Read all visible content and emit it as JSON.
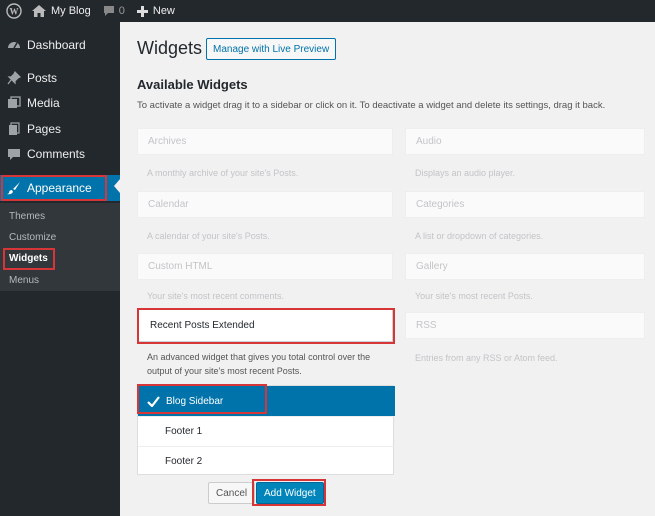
{
  "adminbar": {
    "site_name": "My Blog",
    "comments_count": "0",
    "new_label": "New"
  },
  "sidebar": {
    "items": [
      {
        "label": "Dashboard",
        "icon": "dashboard-icon"
      },
      {
        "label": "Posts",
        "icon": "pin-icon"
      },
      {
        "label": "Media",
        "icon": "media-icon"
      },
      {
        "label": "Pages",
        "icon": "pages-icon"
      },
      {
        "label": "Comments",
        "icon": "comment-icon"
      },
      {
        "label": "Appearance",
        "icon": "brush-icon",
        "current": true
      }
    ],
    "submenu": [
      "Themes",
      "Customize",
      "Widgets",
      "Menus"
    ],
    "current_submenu": "Widgets"
  },
  "main": {
    "title": "Widgets",
    "live_preview_label": "Manage with Live Preview",
    "available_heading": "Available Widgets",
    "description": "To activate a widget drag it to a sidebar or click on it. To deactivate a widget and delete its settings, drag it back.",
    "widgets_left": [
      {
        "title": "Archives",
        "desc": "A monthly archive of your site's Posts."
      },
      {
        "title": "Calendar",
        "desc": "A calendar of your site's Posts."
      },
      {
        "title": "Custom HTML",
        "desc": "Your site's most recent comments."
      }
    ],
    "widgets_right": [
      {
        "title": "Audio",
        "desc": "Displays an audio player."
      },
      {
        "title": "Categories",
        "desc": "A list or dropdown of categories."
      },
      {
        "title": "Gallery",
        "desc": "Your site's most recent Posts."
      },
      {
        "title": "RSS",
        "desc": "Entries from any RSS or Atom feed."
      }
    ],
    "expanded_widget": {
      "title": "Recent Posts Extended",
      "desc": "An advanced widget that gives you total control over the output of your site's most recent Posts."
    },
    "sidebar_choices": [
      "Blog Sidebar",
      "Footer 1",
      "Footer 2"
    ],
    "selected_sidebar": "Blog Sidebar",
    "cancel_label": "Cancel",
    "add_label": "Add Widget"
  },
  "colors": {
    "accent": "#0073aa",
    "highlight": "#d63638",
    "admin_dark": "#23282d"
  }
}
